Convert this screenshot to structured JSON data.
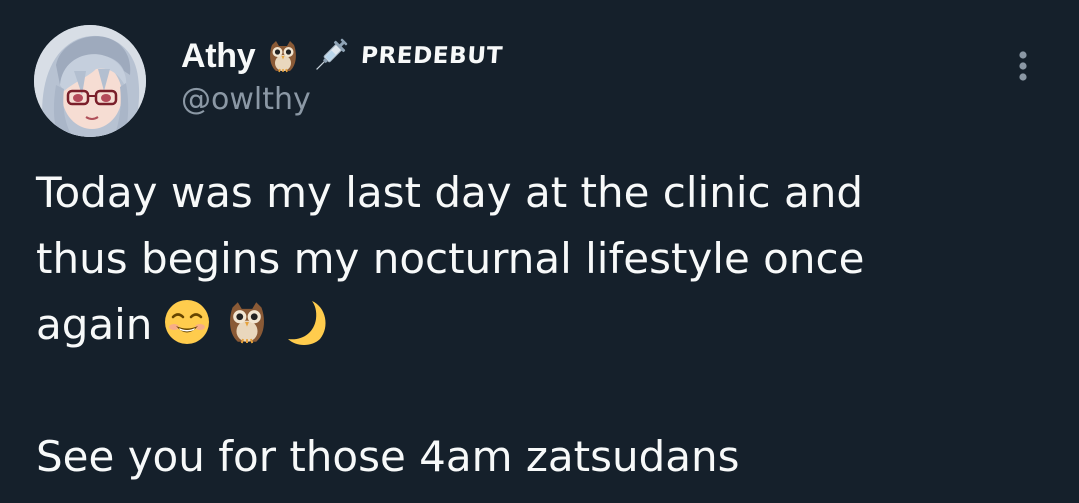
{
  "author": {
    "display_name": "Athy",
    "name_icons": [
      "owl-icon",
      "syringe-icon"
    ],
    "badge": "PREDEBUT",
    "handle": "@owlthy"
  },
  "tweet": {
    "line1": "Today was my last day at the clinic and",
    "line2": "thus begins my nocturnal lifestyle once",
    "line3": "again",
    "line3_emojis": [
      "smiling-face-icon",
      "owl-icon",
      "crescent-moon-icon"
    ],
    "line4": "See you for those 4am zatsudans"
  },
  "colors": {
    "background": "#15202b",
    "text": "#f7f9f9",
    "secondary_text": "#8b98a5"
  }
}
